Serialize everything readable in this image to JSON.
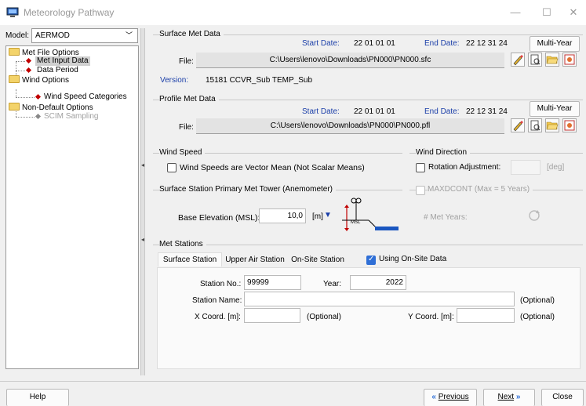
{
  "window": {
    "title": "Meteorology Pathway",
    "min_icon": "minimize-icon",
    "max_icon": "maximize-icon",
    "close_icon": "close-icon"
  },
  "model": {
    "label": "Model:",
    "value": "AERMOD"
  },
  "tree": {
    "items": [
      {
        "label": "Met File Options",
        "type": "folder"
      },
      {
        "label": "Met Input Data",
        "type": "leaf",
        "selected": true
      },
      {
        "label": "Data Period",
        "type": "leaf"
      },
      {
        "label": "Wind Options",
        "type": "folder"
      },
      {
        "label": "Wind Speed Categories",
        "type": "leaf"
      },
      {
        "label": "Non-Default Options",
        "type": "folder"
      },
      {
        "label": "SCIM Sampling",
        "type": "leaf",
        "disabled": true
      }
    ]
  },
  "surface_met": {
    "title": "Surface Met Data",
    "start_label": "Start Date:",
    "start_value": "22 01 01 01",
    "end_label": "End Date:",
    "end_value": "22 12 31 24",
    "multi_year": "Multi-Year",
    "file_label": "File:",
    "file_path": "C:\\Users\\lenovo\\Downloads\\PN000\\PN000.sfc",
    "version_label": "Version:",
    "version_value": "15181 CCVR_Sub TEMP_Sub"
  },
  "profile_met": {
    "title": "Profile Met Data",
    "start_label": "Start Date:",
    "start_value": "22 01 01 01",
    "end_label": "End Date:",
    "end_value": "22 12 31 24",
    "multi_year": "Multi-Year",
    "file_label": "File:",
    "file_path": "C:\\Users\\lenovo\\Downloads\\PN000\\PN000.pfl"
  },
  "wind_speed": {
    "title": "Wind Speed",
    "vector_mean": "Wind Speeds are Vector Mean (Not Scalar Means)"
  },
  "wind_direction": {
    "title": "Wind Direction",
    "rotation": "Rotation Adjustment:",
    "unit": "[deg]"
  },
  "tower": {
    "title": "Surface Station Primary Met Tower (Anemometer)",
    "base_label": "Base Elevation (MSL):",
    "base_value": "10,0",
    "unit": "[m]",
    "msl": "MSL"
  },
  "maxdcont": {
    "label": "MAXDCONT (Max = 5 Years)",
    "years_label": "# Met Years:"
  },
  "met_stations": {
    "title": "Met Stations",
    "tabs": [
      "Surface Station",
      "Upper Air Station",
      "On-Site Station"
    ],
    "using_onsite": "Using On-Site Data",
    "station_no_label": "Station No.:",
    "station_no": "99999",
    "year_label": "Year:",
    "year": "2022",
    "name_label": "Station Name:",
    "optional": "(Optional)",
    "x_label": "X Coord. [m]:",
    "y_label": "Y Coord. [m]:"
  },
  "footer": {
    "help": "Help",
    "previous": "Previous",
    "next": "Next",
    "close": "Close"
  },
  "colors": {
    "accent": "#2f6fd6",
    "selected_diamond": "#c00000"
  }
}
